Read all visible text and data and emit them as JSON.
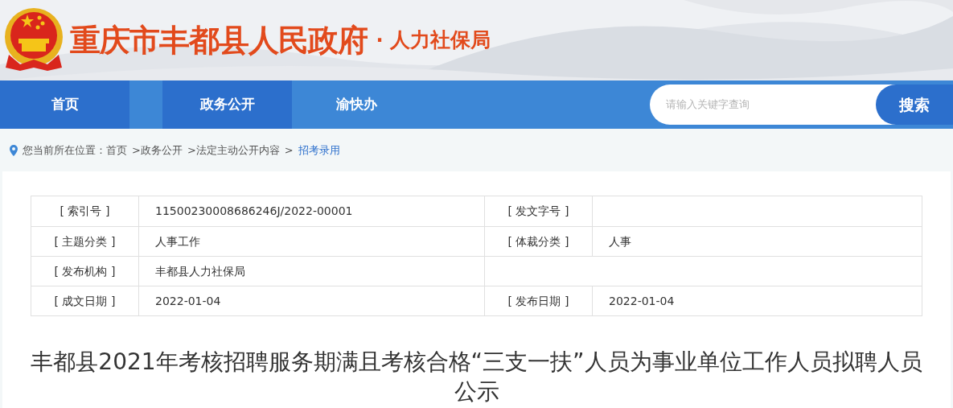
{
  "header": {
    "site_title": "重庆市丰都县人民政府",
    "separator": "·",
    "department": "人力社保局"
  },
  "nav": {
    "items": [
      {
        "label": "首页",
        "selected": true
      },
      {
        "label": "政务公开",
        "selected": true
      },
      {
        "label": "渝快办",
        "selected": false
      }
    ],
    "search": {
      "placeholder": "请输入关键字查询",
      "button": "搜索"
    }
  },
  "breadcrumb": [
    {
      "text": "您当前所在位置：首页",
      "current": false
    },
    {
      "text": ">政务公开",
      "current": false
    },
    {
      "text": ">法定主动公开内容",
      "current": false
    },
    {
      "text": ">",
      "current": false
    },
    {
      "text": "招考录用",
      "current": true
    }
  ],
  "info_table": {
    "rows": [
      {
        "cells": [
          {
            "label": "[ 索引号 ]",
            "value": "11500230008686246J/2022-00001"
          },
          {
            "label": "[ 发文字号 ]"
          }
        ]
      },
      {
        "cells": [
          {
            "label": "[ 主题分类 ]",
            "value": "人事工作"
          },
          {
            "label": "[ 体裁分类 ]",
            "value": "人事"
          }
        ]
      },
      {
        "cells": [
          {
            "label": "[ 发布机构 ]",
            "value": "丰都县人力社保局"
          }
        ]
      },
      {
        "cells": [
          {
            "label": "[ 成文日期 ]",
            "value": "2022-01-04"
          },
          {
            "label": "[ 发布日期 ]",
            "value": "2022-01-04"
          }
        ]
      }
    ]
  },
  "article": {
    "title": "丰都县2021年考核招聘服务期满且考核合格“三支一扶”人员为事业单位工作人员拟聘人员公示"
  }
}
